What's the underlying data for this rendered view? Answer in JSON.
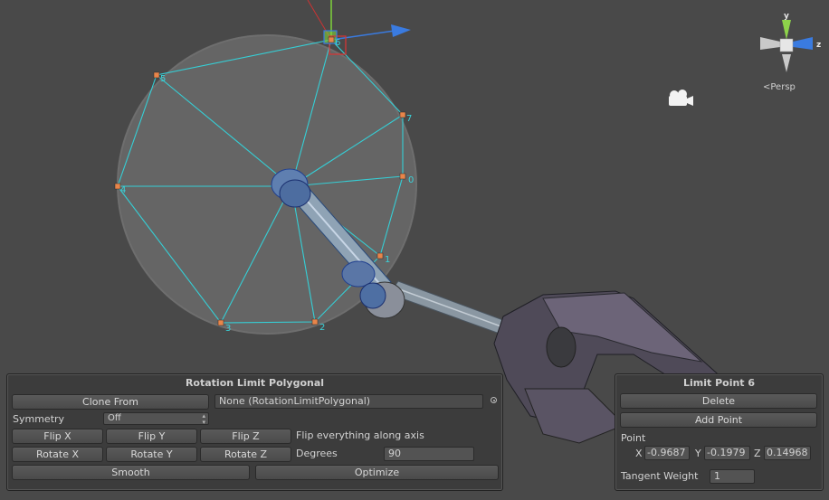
{
  "scene": {
    "persp_label": "<Persp",
    "axis_labels": {
      "y": "y",
      "z": "z"
    },
    "point_labels": [
      "0",
      "1",
      "2",
      "3",
      "4",
      "5",
      "6",
      "7"
    ],
    "colors": {
      "background": "#494949",
      "sphere": "#666666",
      "polygon": "#35cfd6",
      "point": "#e8854a",
      "gizmo_y": "#8dd34a",
      "gizmo_z": "#3a7be0"
    },
    "icons": [
      "camera-icon",
      "view-gizmo-icon"
    ]
  },
  "rotation_panel": {
    "title": "Rotation Limit Polygonal",
    "clone_from_button": "Clone From",
    "clone_from_field": "None (RotationLimitPolygonal)",
    "symmetry_label": "Symmetry",
    "symmetry_value": "Off",
    "flip_x": "Flip X",
    "flip_y": "Flip Y",
    "flip_z": "Flip Z",
    "flip_hint": "Flip everything along axis",
    "rotate_x": "Rotate X",
    "rotate_y": "Rotate Y",
    "rotate_z": "Rotate Z",
    "degrees_label": "Degrees",
    "degrees_value": "90",
    "smooth": "Smooth",
    "optimize": "Optimize"
  },
  "limit_point_panel": {
    "title": "Limit Point 6",
    "delete": "Delete",
    "add_point": "Add Point",
    "point_label": "Point",
    "x_label": "X",
    "x_value": "-0.9687",
    "y_label": "Y",
    "y_value": "-0.1979",
    "z_label": "Z",
    "z_value": "0.14968",
    "tangent_label": "Tangent Weight",
    "tangent_value": "1"
  }
}
